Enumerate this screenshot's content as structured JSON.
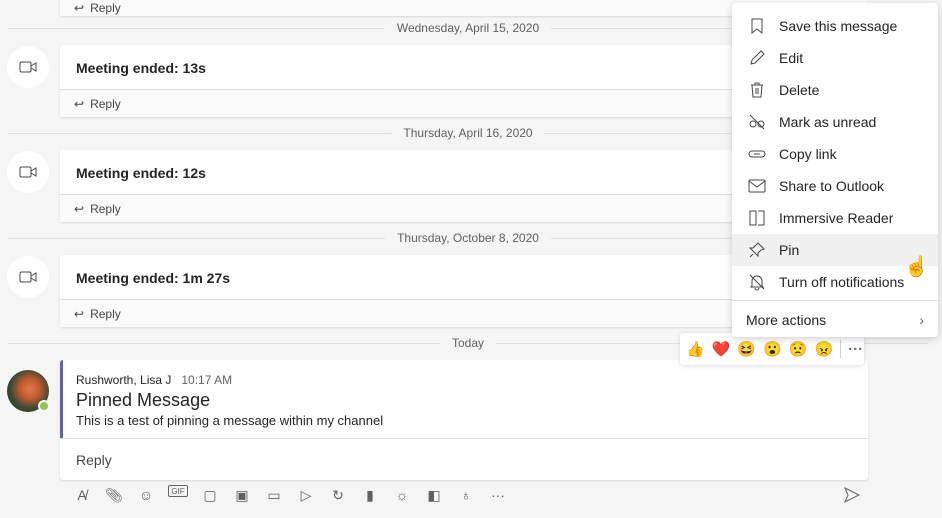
{
  "top_reply": "Reply",
  "meetings": [
    {
      "date": "Wednesday, April 15, 2020",
      "title": "Meeting ended: 13s",
      "reply": "Reply"
    },
    {
      "date": "Thursday, April 16, 2020",
      "title": "Meeting ended: 12s",
      "reply": "Reply"
    },
    {
      "date": "Thursday, October 8, 2020",
      "title": "Meeting ended: 1m 27s",
      "reply": "Reply"
    }
  ],
  "today_label": "Today",
  "pinned": {
    "author": "Rushworth, Lisa J",
    "time": "10:17 AM",
    "subject": "Pinned Message",
    "body": "This is a test of pinning a message within my channel",
    "reply": "Reply",
    "accent": "#6264a7",
    "presence": "#92c353"
  },
  "menu": {
    "items": [
      {
        "label": "Save this message",
        "icon": "bookmark-icon"
      },
      {
        "label": "Edit",
        "icon": "pencil-icon"
      },
      {
        "label": "Delete",
        "icon": "trash-icon"
      },
      {
        "label": "Mark as unread",
        "icon": "unread-glasses-icon"
      },
      {
        "label": "Copy link",
        "icon": "link-icon"
      },
      {
        "label": "Share to Outlook",
        "icon": "mail-icon"
      },
      {
        "label": "Immersive Reader",
        "icon": "immersive-reader-icon"
      },
      {
        "label": "Pin",
        "icon": "pin-icon"
      },
      {
        "label": "Turn off notifications",
        "icon": "bell-off-icon"
      }
    ],
    "more": "More actions"
  },
  "reactions": [
    "👍",
    "❤️",
    "😆",
    "😮",
    "😟",
    "😠"
  ],
  "toolbar": [
    "format",
    "attach",
    "emoji",
    "gif",
    "sticker",
    "meeting",
    "video",
    "stream",
    "loop",
    "praise",
    "weather",
    "whiteboard",
    "idea",
    "more"
  ]
}
